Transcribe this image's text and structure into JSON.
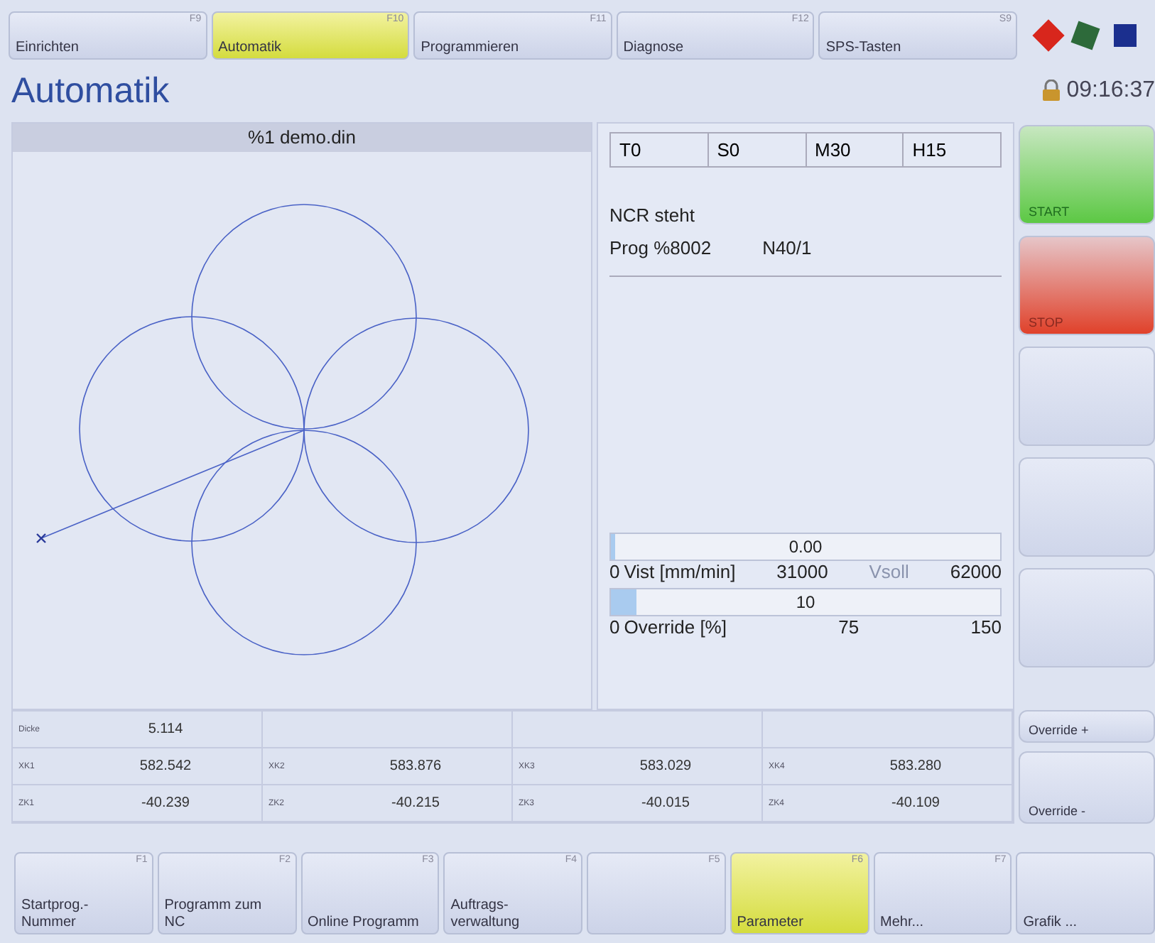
{
  "top_keys": [
    {
      "label": "Einrichten",
      "key": "F9",
      "selected": false
    },
    {
      "label": "Automatik",
      "key": "F10",
      "selected": true
    },
    {
      "label": "Programmieren",
      "key": "F11",
      "selected": false
    },
    {
      "label": "Diagnose",
      "key": "F12",
      "selected": false
    },
    {
      "label": "SPS-Tasten",
      "key": "S9",
      "selected": false
    }
  ],
  "title": "Automatik",
  "time": "09:16:37",
  "graphic": {
    "title": "%1 demo.din"
  },
  "status": {
    "cells": [
      "T0",
      "S0",
      "M30",
      "H15"
    ],
    "state": "NCR steht",
    "program": "Prog %8002",
    "block": "N40/1"
  },
  "meters": [
    {
      "value": "0.00",
      "level": 0.0,
      "min": "0",
      "label": "Vist [mm/min]",
      "mid": "31000",
      "extra": "Vsoll",
      "max": "62000"
    },
    {
      "value": "10",
      "level": 0.067,
      "min": "0",
      "label": "Override [%]",
      "mid": "75",
      "max": "150"
    }
  ],
  "side_keys": [
    {
      "label": "START",
      "kind": "start"
    },
    {
      "label": "STOP",
      "kind": "stop"
    },
    {
      "kind": "blank"
    },
    {
      "kind": "blank"
    },
    {
      "kind": "blank"
    },
    {
      "label": "Override +",
      "kind": "blank"
    },
    {
      "label": "Override -",
      "kind": "blank"
    }
  ],
  "table": {
    "rows": [
      [
        {
          "name": "Dicke",
          "value": "5.114"
        },
        {},
        {},
        {}
      ],
      [
        {
          "name": "XK1",
          "value": "582.542"
        },
        {
          "name": "XK2",
          "value": "583.876"
        },
        {
          "name": "XK3",
          "value": "583.029"
        },
        {
          "name": "XK4",
          "value": "583.280"
        }
      ],
      [
        {
          "name": "ZK1",
          "value": "-40.239"
        },
        {
          "name": "ZK2",
          "value": "-40.215"
        },
        {
          "name": "ZK3",
          "value": "-40.015"
        },
        {
          "name": "ZK4",
          "value": "-40.109"
        }
      ]
    ]
  },
  "bottom_keys": [
    {
      "label": "Startprog.-\nNummer",
      "key": "F1",
      "selected": false
    },
    {
      "label": "Programm zum\nNC",
      "key": "F2",
      "selected": false
    },
    {
      "label": "Online Programm",
      "key": "F3",
      "selected": false
    },
    {
      "label": "Auftrags-\nverwaltung",
      "key": "F4",
      "selected": false
    },
    {
      "key": "F5",
      "selected": false
    },
    {
      "label": "Parameter",
      "key": "F6",
      "selected": true
    },
    {
      "label": "Mehr...",
      "key": "F7",
      "selected": false
    },
    {
      "label": "Grafik ...",
      "selected": false
    }
  ]
}
